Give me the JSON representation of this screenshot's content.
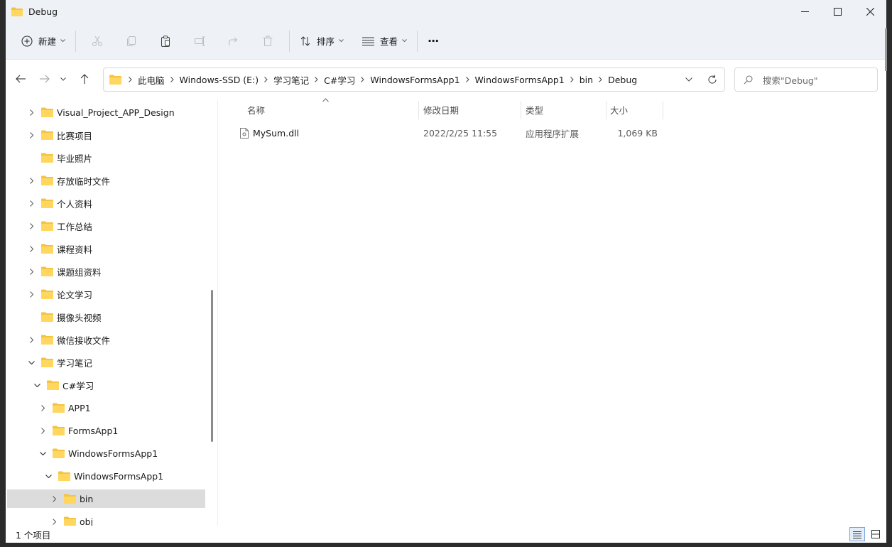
{
  "window": {
    "title": "Debug"
  },
  "toolbar": {
    "new_label": "新建",
    "sort_label": "排序",
    "view_label": "查看",
    "more_label": "···"
  },
  "address": {
    "crumbs": [
      "此电脑",
      "Windows-SSD (E:)",
      "学习笔记",
      "C#学习",
      "WindowsFormsApp1",
      "WindowsFormsApp1",
      "bin",
      "Debug"
    ]
  },
  "search": {
    "placeholder": "搜索\"Debug\""
  },
  "nav": {
    "items": [
      {
        "label": "Visual_Project_APP_Design",
        "expand": "collapsed",
        "depth": 0
      },
      {
        "label": "比赛项目",
        "expand": "collapsed",
        "depth": 0
      },
      {
        "label": "毕业照片",
        "expand": "none",
        "depth": 0
      },
      {
        "label": "存放临时文件",
        "expand": "collapsed",
        "depth": 0
      },
      {
        "label": "个人资料",
        "expand": "collapsed",
        "depth": 0
      },
      {
        "label": "工作总结",
        "expand": "collapsed",
        "depth": 0
      },
      {
        "label": "课程资料",
        "expand": "collapsed",
        "depth": 0
      },
      {
        "label": "课题组资料",
        "expand": "collapsed",
        "depth": 0
      },
      {
        "label": "论文学习",
        "expand": "collapsed",
        "depth": 0
      },
      {
        "label": "摄像头视频",
        "expand": "none",
        "depth": 0
      },
      {
        "label": "微信接收文件",
        "expand": "collapsed",
        "depth": 0
      },
      {
        "label": "学习笔记",
        "expand": "expanded",
        "depth": 0
      },
      {
        "label": "C#学习",
        "expand": "expanded",
        "depth": 1
      },
      {
        "label": "APP1",
        "expand": "collapsed",
        "depth": 2
      },
      {
        "label": "FormsApp1",
        "expand": "collapsed",
        "depth": 2
      },
      {
        "label": "WindowsFormsApp1",
        "expand": "expanded",
        "depth": 2
      },
      {
        "label": "WindowsFormsApp1",
        "expand": "expanded",
        "depth": 3
      },
      {
        "label": "bin",
        "expand": "collapsed",
        "depth": 4,
        "selected": true
      },
      {
        "label": "obj",
        "expand": "collapsed",
        "depth": 4
      }
    ]
  },
  "columns": {
    "name": "名称",
    "modified": "修改日期",
    "type": "类型",
    "size": "大小"
  },
  "files": [
    {
      "name": "MySum.dll",
      "modified": "2022/2/25 11:55",
      "type": "应用程序扩展",
      "size": "1,069 KB"
    }
  ],
  "status": {
    "count_text": "1 个项目"
  },
  "colors": {
    "chrome": "#eef1f6",
    "folder": "#f5c242",
    "selected": "#dcdcdc",
    "accent": "#7aa6d8"
  }
}
